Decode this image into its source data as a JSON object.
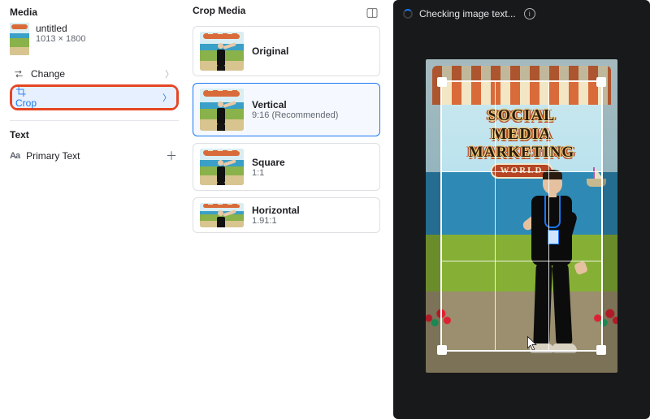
{
  "left": {
    "media_header": "Media",
    "file": {
      "title": "untitled",
      "dimensions": "1013 × 1800"
    },
    "change_label": "Change",
    "crop_label": "Crop",
    "text_header": "Text",
    "primary_text_label": "Primary Text"
  },
  "mid": {
    "header": "Crop Media",
    "options": [
      {
        "title": "Original",
        "sub": ""
      },
      {
        "title": "Vertical",
        "sub": "9:16 (Recommended)"
      },
      {
        "title": "Square",
        "sub": "1:1"
      },
      {
        "title": "Horizontal",
        "sub": "1.91:1"
      }
    ],
    "selected_index": 1
  },
  "right": {
    "status_text": "Checking image text...",
    "sign": {
      "l1": "SOCIAL MEDIA",
      "l2": "MARKETING",
      "l3": "WORLD"
    }
  },
  "colors": {
    "accent": "#1877f2",
    "highlight_border": "#e64523",
    "dark_bg": "#18191a"
  }
}
